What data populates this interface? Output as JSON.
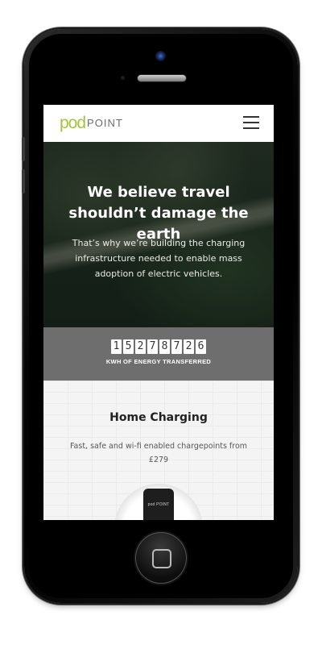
{
  "header": {
    "logo_pod": "pod",
    "logo_point": "POINT",
    "menu_icon": "hamburger-menu-icon"
  },
  "hero": {
    "title": "We believe travel shouldn’t damage the earth",
    "text": "That’s why we’re building the charging infrastructure needed to enable mass adoption of electric vehicles."
  },
  "counter": {
    "digits": [
      "1",
      "5",
      "2",
      "7",
      "8",
      "7",
      "2",
      "6"
    ],
    "label": "KWH OF ENERGY TRANSFERRED"
  },
  "home_charging": {
    "title": "Home Charging",
    "text": "Fast, safe and wi-fi enabled chargepoints from £279",
    "charger_logo": "pod POINT"
  },
  "colors": {
    "brand_green": "#a7c13a",
    "counter_bg": "#6e6e6e"
  }
}
